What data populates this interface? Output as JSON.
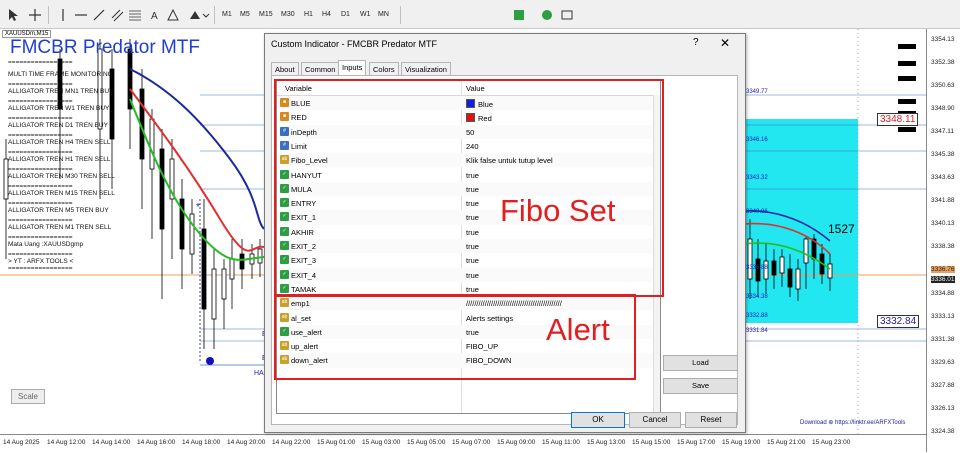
{
  "toolbar": {
    "timeframes": [
      "M1",
      "M5",
      "M15",
      "M30",
      "H1",
      "H4",
      "D1",
      "W1",
      "MN"
    ]
  },
  "chart": {
    "symbol_tag": "XAUUSDm,M15",
    "title": "FMCBR Predator MTF",
    "info_lines": [
      "=================",
      "MULTI TIME FRAME MONITORING",
      "=================",
      "ALLIGATOR TREN MN1  TREN  BUY",
      "=================",
      "ALLIGATOR TREN W1 TREN  BUY",
      "=================",
      "ALLIGATOR TREN D1 TREN  BUY",
      "=================",
      "ALLIGATOR TREN H4  TREN  SELL",
      "=================",
      "ALLIGATOR TREN H1  TREN  SELL",
      "=================",
      "ALLIGATOR TREN M30  TREN  SELL",
      "=================",
      "ALLIGATOR TREN M15  TREN  SELL",
      "=================",
      "ALLIGATOR TREN M5 TREN  BUY",
      "=================",
      "ALLIGATOR TREN M1  TREN  SELL",
      "=================",
      "Mata Uang :XAUUSDgmp",
      "=================",
      "> YT : ARFX TOOLS <",
      "================="
    ],
    "scale_label": "Scale",
    "fibo_labels": [
      "3349.77",
      "3346.16",
      "3343.32",
      "3340.96",
      "3336.88",
      "3334.38",
      "3332.88",
      "3331.84"
    ],
    "number_1527": "1527",
    "boxed_high": "3348.11",
    "boxed_low": "3332.84",
    "download_text": "Download  ⊕  https://linktr.ee/ARFXTools",
    "left_letters": [
      "E",
      "E",
      "HA"
    ]
  },
  "price_axis": [
    "3354.13",
    "3352.38",
    "3350.63",
    "3348.90",
    "3347.11",
    "3345.38",
    "3343.63",
    "3341.88",
    "3340.13",
    "3338.38",
    "3336.63",
    "3334.88",
    "3333.13",
    "3331.38",
    "3329.63",
    "3327.88",
    "3326.13",
    "3324.38"
  ],
  "price_markers": {
    "current_red": "3336.76",
    "current_black": "3336.01"
  },
  "time_axis": [
    "14 Aug 2025",
    "14 Aug 12:00",
    "14 Aug 14:00",
    "14 Aug 16:00",
    "14 Aug 18:00",
    "14 Aug 20:00",
    "14 Aug 22:00",
    "15 Aug 01:00",
    "15 Aug 03:00",
    "15 Aug 05:00",
    "15 Aug 07:00",
    "15 Aug 09:00",
    "15 Aug 11:00",
    "15 Aug 13:00",
    "15 Aug 15:00",
    "15 Aug 17:00",
    "15 Aug 19:00",
    "15 Aug 21:00",
    "15 Aug 23:00"
  ],
  "dialog": {
    "title": "Custom Indicator - FMCBR Predator MTF",
    "help": "?",
    "close": "✕",
    "tabs": [
      "About",
      "Common",
      "Inputs",
      "Colors",
      "Visualization"
    ],
    "header_variable": "Variable",
    "header_value": "Value",
    "rows": [
      {
        "icon": "col",
        "variable": "BLUE",
        "value": "Blue",
        "swatch": "#1020e0"
      },
      {
        "icon": "col",
        "variable": "RED",
        "value": "Red",
        "swatch": "#e01010"
      },
      {
        "icon": "int",
        "variable": "inDepth",
        "value": "50"
      },
      {
        "icon": "int",
        "variable": "Limit",
        "value": "240"
      },
      {
        "icon": "str",
        "variable": "Fibo_Level",
        "value": "Klik false untuk tutup level"
      },
      {
        "icon": "bool",
        "variable": "HANYUT",
        "value": "true"
      },
      {
        "icon": "bool",
        "variable": "MULA",
        "value": "true"
      },
      {
        "icon": "bool",
        "variable": "ENTRY",
        "value": "true"
      },
      {
        "icon": "bool",
        "variable": "EXIT_1",
        "value": "true"
      },
      {
        "icon": "bool",
        "variable": "AKHIR",
        "value": "true"
      },
      {
        "icon": "bool",
        "variable": "EXIT_2",
        "value": "true"
      },
      {
        "icon": "bool",
        "variable": "EXIT_3",
        "value": "true"
      },
      {
        "icon": "bool",
        "variable": "EXIT_4",
        "value": "true"
      },
      {
        "icon": "bool",
        "variable": "TAMAK",
        "value": "true"
      },
      {
        "icon": "str",
        "variable": "emp1",
        "value": "//////////////////////////////////////////////"
      },
      {
        "icon": "str",
        "variable": "al_set",
        "value": "Alerts settings"
      },
      {
        "icon": "bool",
        "variable": "use_alert",
        "value": "true"
      },
      {
        "icon": "str",
        "variable": "up_alert",
        "value": "FIBO_UP"
      },
      {
        "icon": "str",
        "variable": "down_alert",
        "value": "FIBO_DOWN"
      }
    ],
    "load_label": "Load",
    "save_label": "Save",
    "ok_label": "OK",
    "cancel_label": "Cancel",
    "reset_label": "Reset"
  },
  "annotations": {
    "fibo_set": "Fibo Set",
    "alert": "Alert"
  },
  "colors": {
    "annotation_red": "#e02020",
    "fibo_box": "#22e6f0",
    "title_blue": "#1f3fcf"
  }
}
